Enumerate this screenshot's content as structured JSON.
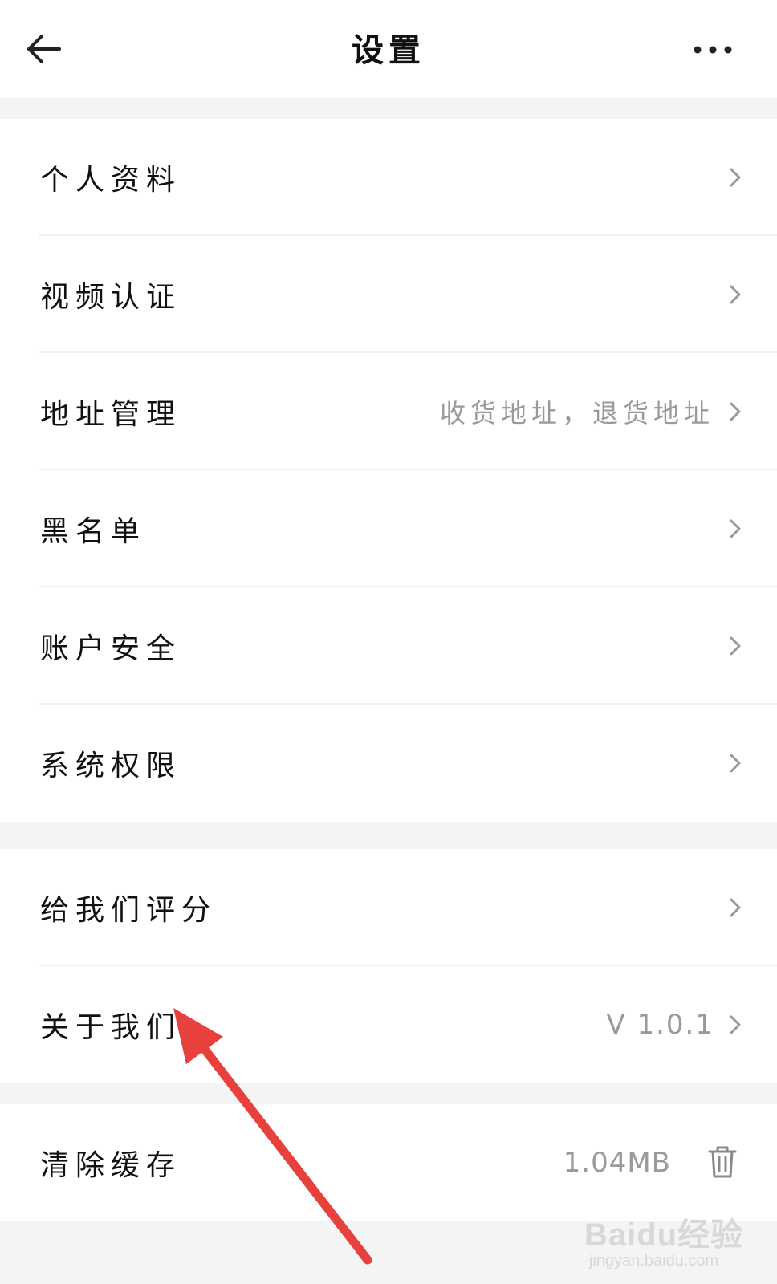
{
  "header": {
    "title": "设置",
    "back_icon": "back-arrow-icon",
    "more_icon": "more-horizontal-icon"
  },
  "groups": [
    {
      "items": [
        {
          "label": "个人资料",
          "value": ""
        },
        {
          "label": "视频认证",
          "value": ""
        },
        {
          "label": "地址管理",
          "value": "收货地址，退货地址"
        },
        {
          "label": "黑名单",
          "value": ""
        },
        {
          "label": "账户安全",
          "value": ""
        },
        {
          "label": "系统权限",
          "value": ""
        }
      ]
    },
    {
      "items": [
        {
          "label": "给我们评分",
          "value": ""
        },
        {
          "label": "关于我们",
          "value": "V 1.0.1"
        }
      ]
    },
    {
      "items": [
        {
          "label": "清除缓存",
          "value": "1.04MB",
          "icon": "trash-icon"
        }
      ]
    }
  ],
  "annotation": {
    "arrow_color": "#e8403c"
  },
  "watermark": {
    "main": "Baidu经验",
    "sub": "jingyan.baidu.com"
  }
}
